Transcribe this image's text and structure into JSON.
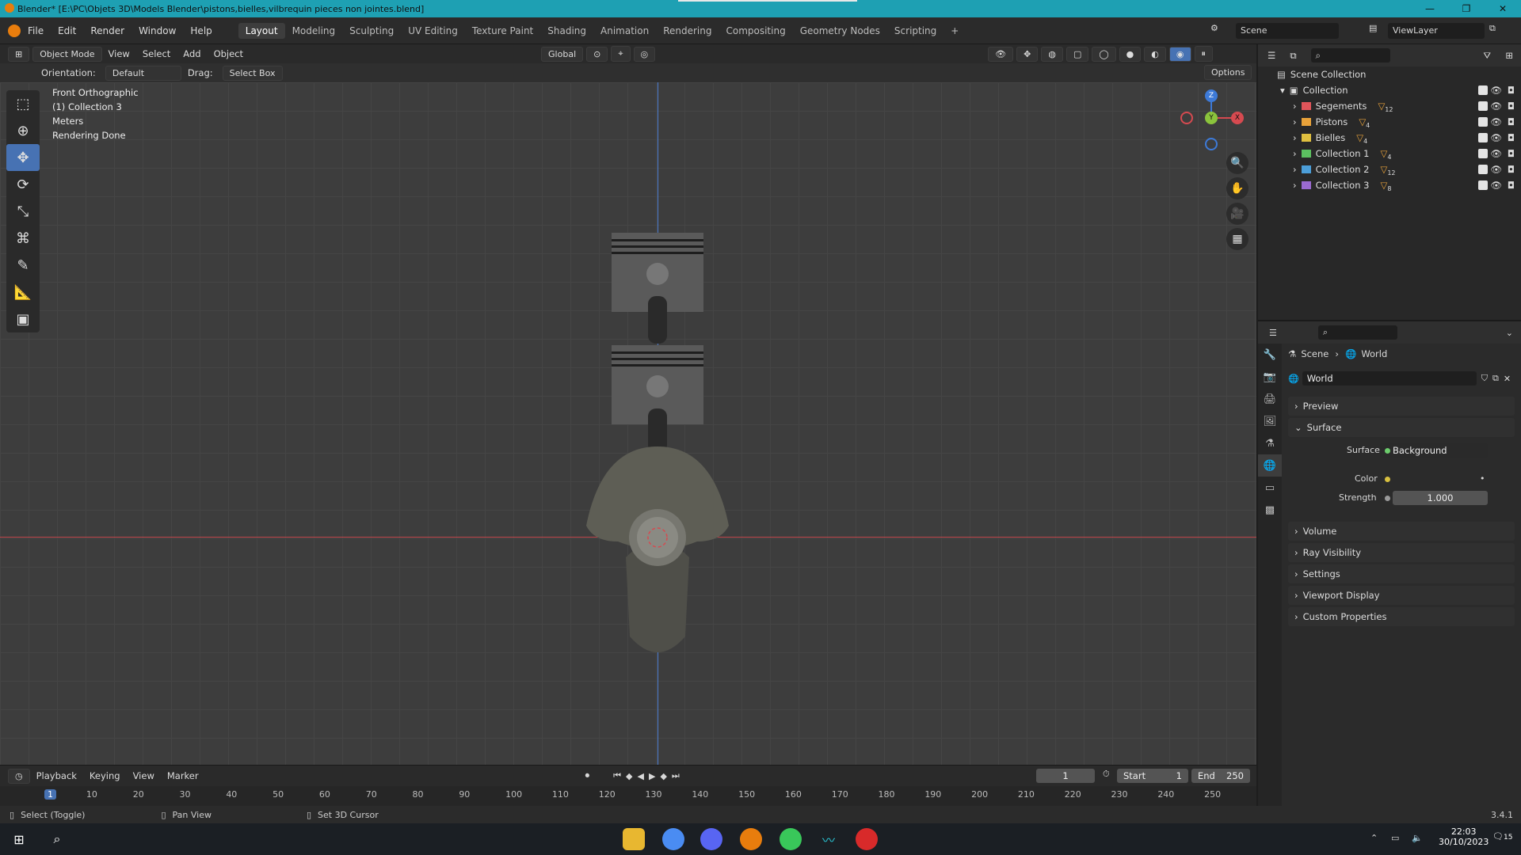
{
  "window": {
    "title": "Blender* [E:\\PC\\Objets 3D\\Models Blender\\pistons,bielles,vilbrequin pieces non jointes.blend]",
    "controls": [
      "—",
      "❐",
      "✕"
    ]
  },
  "menubar": {
    "menus": [
      "File",
      "Edit",
      "Render",
      "Window",
      "Help"
    ],
    "workspaces": [
      "Layout",
      "Modeling",
      "Sculpting",
      "UV Editing",
      "Texture Paint",
      "Shading",
      "Animation",
      "Rendering",
      "Compositing",
      "Geometry Nodes",
      "Scripting"
    ],
    "active_workspace": "Layout",
    "add_tab": "+",
    "scene": "Scene",
    "view_layer": "ViewLayer"
  },
  "viewport_header": {
    "mode": "Object Mode",
    "menus": [
      "View",
      "Select",
      "Add",
      "Object"
    ],
    "transform_orientation": "Global"
  },
  "tool_header": {
    "orientation_label": "Orientation:",
    "orientation_value": "Default",
    "drag_label": "Drag:",
    "drag_value": "Select Box",
    "options": "Options"
  },
  "viewport_info": {
    "view": "Front Orthographic",
    "collection": "(1) Collection 3",
    "units": "Meters",
    "status": "Rendering Done"
  },
  "gizmo": {
    "z": "Z",
    "y": "Y",
    "x": "X"
  },
  "outliner": {
    "root": "Scene Collection",
    "collection": "Collection",
    "items": [
      {
        "name": "Segements",
        "count": "12",
        "color": "#e0555a"
      },
      {
        "name": "Pistons",
        "count": "4",
        "color": "#e8a23a"
      },
      {
        "name": "Bielles",
        "count": "4",
        "color": "#e0c040"
      },
      {
        "name": "Collection 1",
        "count": "4",
        "color": "#5cc060"
      },
      {
        "name": "Collection 2",
        "count": "12",
        "color": "#4c9ed8"
      },
      {
        "name": "Collection 3",
        "count": "8",
        "color": "#9a6ad0"
      }
    ]
  },
  "properties": {
    "breadcrumb_scene": "Scene",
    "breadcrumb_world": "World",
    "world_name": "World",
    "panels": {
      "preview": "Preview",
      "surface": "Surface",
      "volume": "Volume",
      "ray_visibility": "Ray Visibility",
      "settings": "Settings",
      "viewport_display": "Viewport Display",
      "custom_properties": "Custom Properties"
    },
    "surface_label": "Surface",
    "surface_value": "Background",
    "color_label": "Color",
    "strength_label": "Strength",
    "strength_value": "1.000"
  },
  "timeline": {
    "menus": [
      "Playback",
      "Keying",
      "View",
      "Marker"
    ],
    "current_frame": "1",
    "start_label": "Start",
    "start_value": "1",
    "end_label": "End",
    "end_value": "250",
    "ticks": [
      "1",
      "10",
      "20",
      "30",
      "40",
      "50",
      "60",
      "70",
      "80",
      "90",
      "100",
      "110",
      "120",
      "130",
      "140",
      "150",
      "160",
      "170",
      "180",
      "190",
      "200",
      "210",
      "220",
      "230",
      "240",
      "250"
    ]
  },
  "statusbar": {
    "hint1": "Select (Toggle)",
    "hint2": "Pan View",
    "hint3": "Set 3D Cursor",
    "version": "3.4.1"
  },
  "taskbar": {
    "time": "22:03",
    "date": "30/10/2023",
    "notif": "15"
  }
}
